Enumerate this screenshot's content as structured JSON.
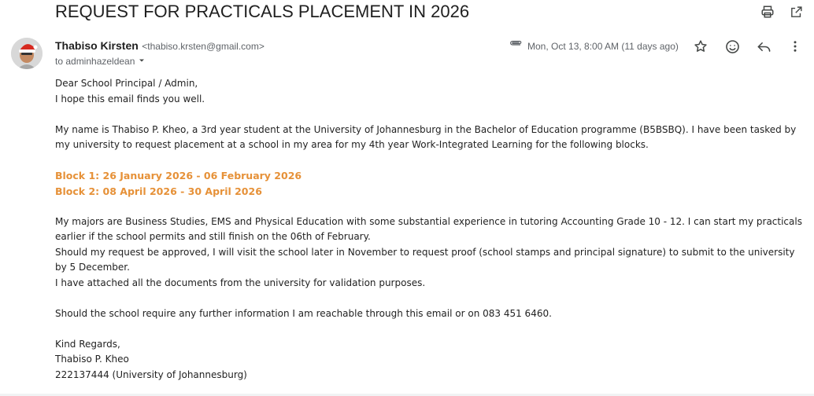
{
  "email": {
    "subject": "REQUEST FOR PRACTICALS PLACEMENT IN 2026",
    "sender_name": "Thabiso Kirsten",
    "sender_email": "<thabiso.krsten@gmail.com>",
    "to_label": "to adminhazeldean",
    "date": "Mon, Oct 13, 8:00 AM (11 days ago)",
    "greeting": "Dear School Principal / Admin,",
    "opening": "I hope this email finds you well.",
    "paragraph1": "My name is Thabiso P. Kheo, a 3rd year student at the University of Johannesburg in the Bachelor of Education programme (B5BSBQ). I have been tasked by my university to request placement at a school in my area for my 4th year Work-Integrated Learning for the following blocks.",
    "block1": "Block 1: 26 January 2026 - 06 February 2026",
    "block2": "Block 2: 08 April 2026 - 30 April 2026",
    "paragraph2": "My majors are Business Studies, EMS and Physical Education with some substantial experience in tutoring Accounting Grade 10 - 12. I can start my practicals earlier if the school permits and still finish on the 06th of February.",
    "paragraph3": "Should my request be approved, I will visit the school later in November to request proof (school stamps and principal signature) to submit to the university by 5 December.",
    "paragraph4": "I have attached all the documents from the university for validation purposes.",
    "paragraph5": "Should the school require any further information I am reachable through this email or on 083 451 6460.",
    "closing": "Kind Regards,",
    "signature_name": "Thabiso P. Kheo",
    "signature_id": "222137444 (University of Johannesburg)"
  },
  "icons": {
    "print": "print-icon",
    "open_new_window": "open-in-new-window-icon",
    "attachment": "paperclip-icon",
    "star": "star-icon",
    "emoji": "emoji-reaction-icon",
    "reply": "reply-icon",
    "more": "more-vertical-icon",
    "dropdown": "caret-down-icon"
  },
  "colors": {
    "block_highlight": "#e69138",
    "secondary_text": "#5f6368"
  }
}
